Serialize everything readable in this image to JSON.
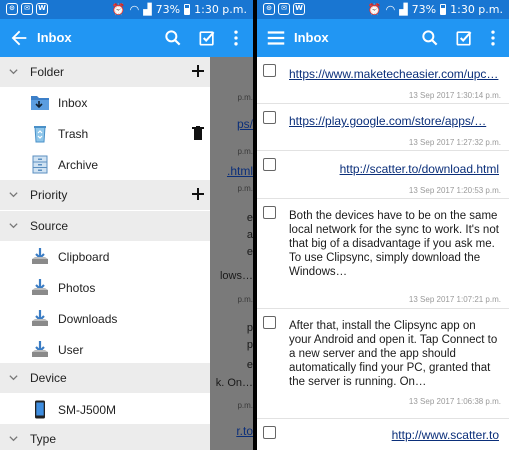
{
  "status": {
    "battery": "73%",
    "time": "1:30 p.m."
  },
  "left": {
    "title": "Inbox",
    "sections": [
      {
        "label": "Folder",
        "items": [
          {
            "label": "Inbox",
            "icon": "inbox-folder-icon"
          },
          {
            "label": "Trash",
            "icon": "recycle-bin-icon"
          },
          {
            "label": "Archive",
            "icon": "archive-cabinet-icon"
          }
        ]
      },
      {
        "label": "Priority",
        "items": []
      },
      {
        "label": "Source",
        "items": [
          {
            "label": "Clipboard",
            "icon": "download-tray-icon"
          },
          {
            "label": "Photos",
            "icon": "download-tray-icon"
          },
          {
            "label": "Downloads",
            "icon": "download-tray-icon"
          },
          {
            "label": "User",
            "icon": "download-tray-icon"
          }
        ]
      },
      {
        "label": "Device",
        "items": [
          {
            "label": "SM-J500M",
            "icon": "smartphone-icon"
          }
        ]
      },
      {
        "label": "Type",
        "items": []
      }
    ],
    "peek": {
      "p1": "p.m.",
      "p2": "ps/",
      "p3": "p.m.",
      "p4": ".html",
      "p5": "p.m.",
      "p6": "e",
      "p7": "a",
      "p8": "e",
      "p9": "lows…",
      "p10": "p.m.",
      "p11": "p",
      "p12": "p",
      "p13": "e",
      "p14": "k. On…",
      "p15": "p.m.",
      "p16": "r.to"
    }
  },
  "right": {
    "title": "Inbox",
    "items": [
      {
        "text": "https://www.maketecheasier.com/upc…",
        "date": "13 Sep 2017 1:30:14 p.m."
      },
      {
        "text": "https://play.google.com/store/apps/…",
        "date": "13 Sep 2017 1:27:32 p.m."
      },
      {
        "text": "http://scatter.to/download.html",
        "date": "13 Sep 2017 1:20:53 p.m."
      },
      {
        "text": "Both the devices have to be on the same local network for the sync to work. It's not that big of a disadvantage if you ask me. To use Clipsync, simply download the Windows…",
        "date": "13 Sep 2017 1:07:21 p.m."
      },
      {
        "text": "After that, install the Clipsync app on your Android and open it. Tap Connect to a new server and the app should automatically find your PC, granted that the server is running. On…",
        "date": "13 Sep 2017 1:06:38 p.m."
      },
      {
        "text": "http://www.scatter.to",
        "date": ""
      }
    ]
  },
  "colors": {
    "statusbar": "#1976d2",
    "appbar": "#2196f3",
    "link": "#0b2f7a",
    "section_bg": "#ececec"
  }
}
